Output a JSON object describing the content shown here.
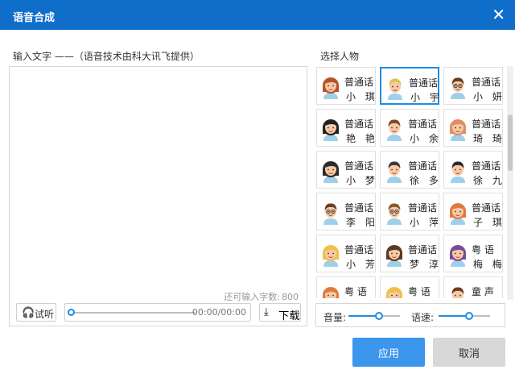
{
  "window": {
    "title": "语音合成"
  },
  "input": {
    "label": "输入文字 ——（语音技术由科大讯飞提供）",
    "value": "",
    "remain_label": "还可输入字数:",
    "remain_count": "800"
  },
  "player": {
    "listen_label": "试听",
    "time": "00:00/00:00",
    "download_label": "下载",
    "progress": 0
  },
  "voices": {
    "label": "选择人物",
    "selected": "小宇",
    "items": [
      {
        "lang": "普通话",
        "name": "小 琪",
        "face": "#f7c9a5",
        "hair": "#b5532b",
        "style": "girl"
      },
      {
        "lang": "普通话",
        "name": "小 宇",
        "face": "#f7c9a5",
        "hair": "#e2c15a",
        "style": "boy"
      },
      {
        "lang": "普通话",
        "name": "小 妍",
        "face": "#f7c9a5",
        "hair": "#6b3e1f",
        "style": "glasses"
      },
      {
        "lang": "普通话",
        "name": "艳 艳",
        "face": "#f7c9a5",
        "hair": "#222222",
        "style": "girl"
      },
      {
        "lang": "普通话",
        "name": "小 余",
        "face": "#f7c9a5",
        "hair": "#7b4a2c",
        "style": "boy"
      },
      {
        "lang": "普通话",
        "name": "琦 琦",
        "face": "#f7c9a5",
        "hair": "#e58a6a",
        "style": "girl"
      },
      {
        "lang": "普通话",
        "name": "小 梦",
        "face": "#f7c9a5",
        "hair": "#2b2b2b",
        "style": "girl"
      },
      {
        "lang": "普通话",
        "name": "徐 多",
        "face": "#f7c9a5",
        "hair": "#3a3a3a",
        "style": "boy"
      },
      {
        "lang": "普通话",
        "name": "徐 九",
        "face": "#f7c9a5",
        "hair": "#2b2b2b",
        "style": "boy"
      },
      {
        "lang": "普通话",
        "name": "李 阳",
        "face": "#f7c9a5",
        "hair": "#6b3e1f",
        "style": "glasses"
      },
      {
        "lang": "普通话",
        "name": "小 萍",
        "face": "#f7c9a5",
        "hair": "#8a5a2b",
        "style": "glasses"
      },
      {
        "lang": "普通话",
        "name": "子 琪",
        "face": "#f7c9a5",
        "hair": "#e07a3c",
        "style": "girl"
      },
      {
        "lang": "普通话",
        "name": "小 芳",
        "face": "#f7c9a5",
        "hair": "#f0c04a",
        "style": "girl"
      },
      {
        "lang": "普通话",
        "name": "梦 淳",
        "face": "#f7c9a5",
        "hair": "#5a3a22",
        "style": "girl"
      },
      {
        "lang": "粤 语",
        "name": "梅 梅",
        "face": "#f7c9a5",
        "hair": "#7a4aa0",
        "style": "girl"
      },
      {
        "lang": "粤 语",
        "name": "",
        "face": "#f7c9a5",
        "hair": "#e07a3c",
        "style": "girl"
      },
      {
        "lang": "粤 语",
        "name": "",
        "face": "#f7c9a5",
        "hair": "#f0c04a",
        "style": "girl"
      },
      {
        "lang": "童 声",
        "name": "",
        "face": "#f7c9a5",
        "hair": "#6b3e1f",
        "style": "boy"
      }
    ]
  },
  "settings": {
    "volume_label": "音量:",
    "volume": 0.6,
    "speed_label": "语速:",
    "speed": 0.6
  },
  "actions": {
    "apply": "应用",
    "cancel": "取消"
  },
  "colors": {
    "accent": "#0f6ec9",
    "selected_border": "#1e8be6",
    "apply_bg": "#3b96ec"
  }
}
